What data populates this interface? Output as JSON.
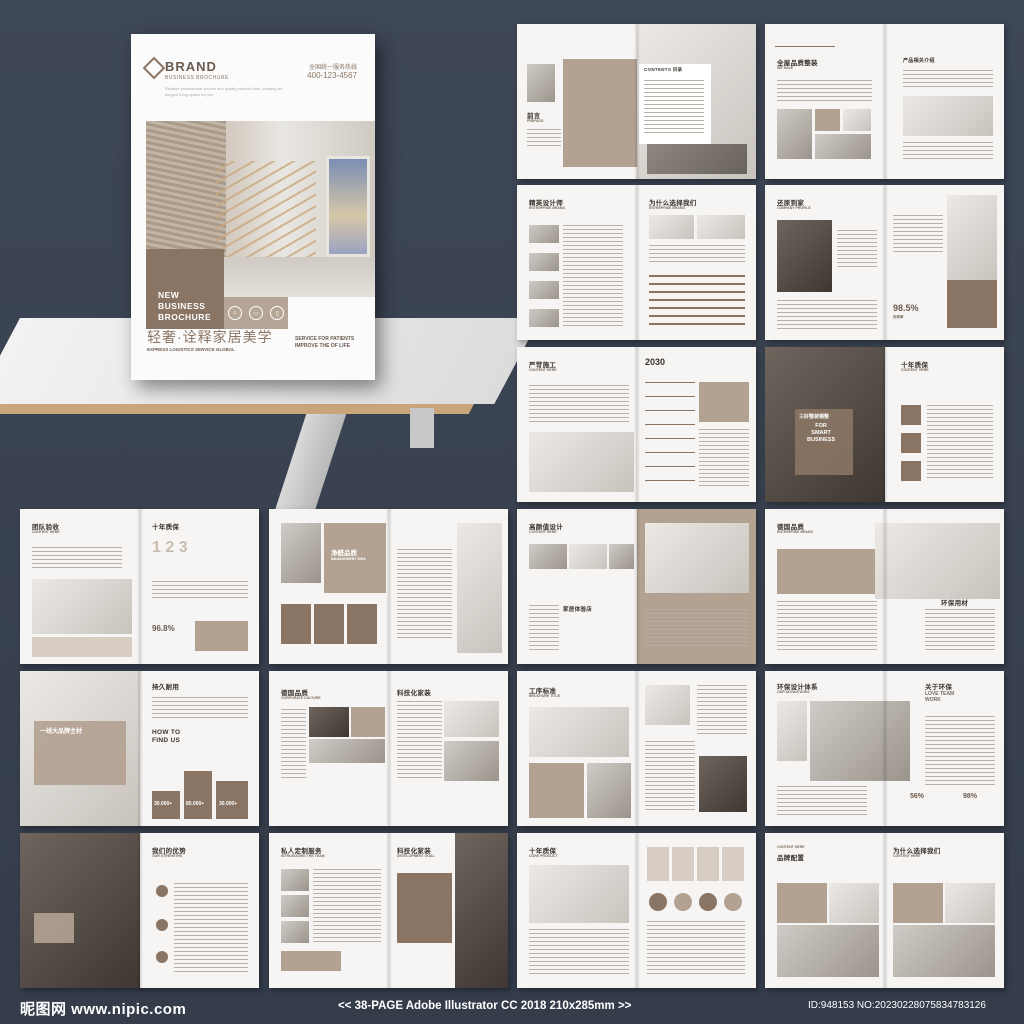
{
  "cover": {
    "brand": "BRAND",
    "brand_sub": "BUSINESS BROCHURE",
    "hotline": "全国统一服务热线",
    "phone": "400-123-4567",
    "small_text": "Reliable professional service and quality product lines, creating an elegant living space for you",
    "block_title_1": "NEW",
    "block_title_2": "BUSINESS",
    "block_title_3": "BROCHURE",
    "title_cn": "轻奢·诠释家居美学",
    "title_sub": "EXPRESS LOGISTICS SERVICE GLOBAL",
    "service_1": "SERVICE FOR PATIENTS",
    "service_2": "IMPROVE THE OF LIFE"
  },
  "spreads": [
    {
      "title": "前言",
      "sub": "PREFACE",
      "right_title": "CONTENTS 目录"
    },
    {
      "title": "全屋品质整装",
      "sub": "WE HAVE",
      "right_title": "产品相关介绍"
    },
    {
      "title": "精英设计师",
      "sub": "ENTERPRISE BRAND",
      "right_title": "为什么选择我们",
      "right_sub": "ENTERPRISE BRAND"
    },
    {
      "title": "还原到家",
      "sub": "COMPANY PROFILE",
      "stat": "98.5%",
      "stat_label": "优秀率"
    },
    {
      "title": "严苛施工",
      "sub": "CONTENT HERE",
      "year": "2030"
    },
    {
      "title": "十年质保",
      "sub": "CONTENT HERE",
      "box_title": "三好整装钢整",
      "box_en_1": "FOR",
      "box_en_2": "SMART",
      "box_en_3": "BUSINESS"
    },
    {
      "title": "团队验收",
      "sub": "CONTENT HERE",
      "right_title": "十年质保",
      "stat": "96.8%"
    },
    {
      "title": "净醛品质",
      "sub": "MANAGEMENT IDEA"
    },
    {
      "title": "高颜值设计",
      "sub": "CONTENT HERE",
      "mid_title": "家居体验店"
    },
    {
      "title": "德国品质",
      "sub": "ENTERPRISE BRAND",
      "right_title": "环保用材"
    },
    {
      "title": "持久耐用",
      "box_title": "一线大品牌主材",
      "left_heading_1": "HOW TO",
      "left_heading_2": "FIND US",
      "n1": "30.000+",
      "n2": "85.000+",
      "n3": "30.000+"
    },
    {
      "title": "德国品质",
      "sub": "CORPORATE CULTURE",
      "right_title": "科技化家装"
    },
    {
      "title": "工序标准",
      "sub": "BROCHURE TITLE"
    },
    {
      "title": "环保设计体系",
      "sub": "OUR ADVANTAGES",
      "right_title": "关于环保",
      "right_sub_1": "LOVE TEAM",
      "right_sub_2": "WORK",
      "p1": "56%",
      "p2": "98%"
    },
    {
      "title": "我们的优势",
      "sub": "OUR STRENGTHS"
    },
    {
      "title": "私人定制服务",
      "sub": "INTRODUCING THE TEAM",
      "right_title": "科技化家装",
      "right_sub": "DEVELOPMENT GOAL"
    },
    {
      "title": "十年质保",
      "sub": "CORE PRODUCT"
    },
    {
      "title": "品牌配置",
      "sub": "CONTENT HERE",
      "right_title": "为什么选择我们",
      "right_sub": "CONTENT HERE"
    }
  ],
  "footer": {
    "logo": "昵图网 www.nipic.com",
    "spec": "<< 38-PAGE  Adobe Illustrator CC 2018  210x285mm >>",
    "id": "ID:948153 NO:20230228075834783126"
  },
  "colors": {
    "accent": "#8a7564",
    "background": "#3a4352"
  }
}
